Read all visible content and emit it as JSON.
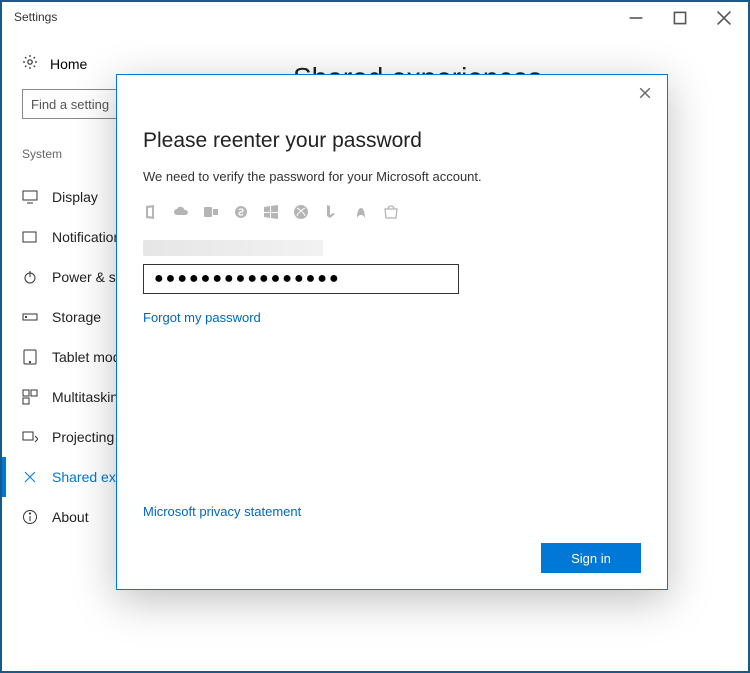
{
  "window": {
    "title": "Settings"
  },
  "home": {
    "label": "Home"
  },
  "search": {
    "placeholder": "Find a setting"
  },
  "section": {
    "label": "System"
  },
  "nav": {
    "display": "Display",
    "notifications": "Notifications",
    "power": "Power & sle",
    "storage": "Storage",
    "tablet": "Tablet mod",
    "multitasking": "Multitaskin",
    "projecting": "Projecting t",
    "shared": "Shared exp",
    "about": "About"
  },
  "page": {
    "title": "Shared experiences"
  },
  "modal": {
    "title": "Please reenter your password",
    "subtext": "We need to verify the password for your Microsoft account.",
    "password_dots": "●●●●●●●●●●●●●●●●",
    "forgot": "Forgot my password",
    "privacy": "Microsoft privacy statement",
    "signin": "Sign in"
  }
}
